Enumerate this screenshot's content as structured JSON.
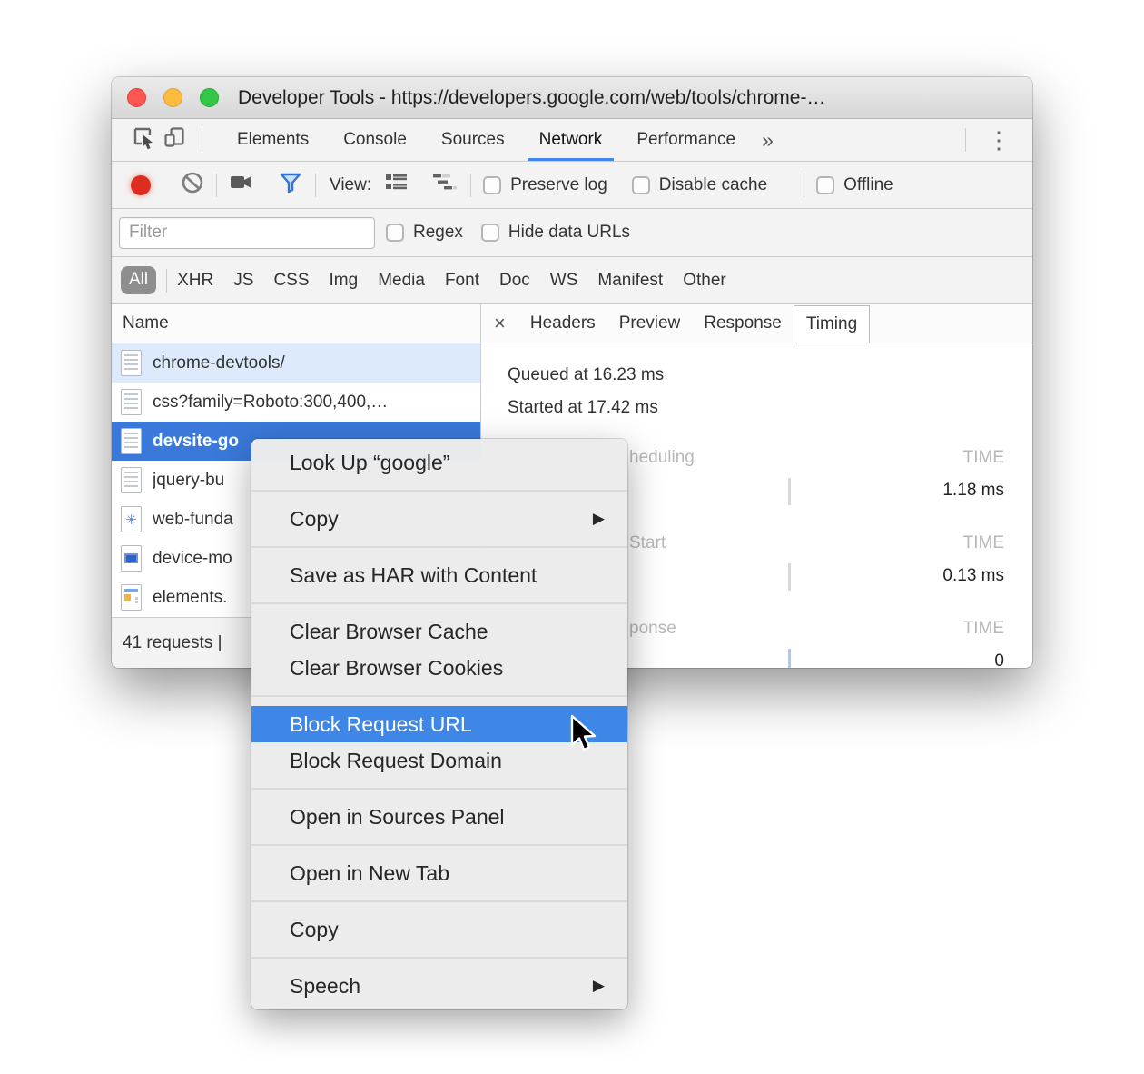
{
  "titlebar": {
    "title": "Developer Tools - https://developers.google.com/web/tools/chrome-…"
  },
  "tabbar": {
    "tabs": [
      "Elements",
      "Console",
      "Sources",
      "Network",
      "Performance"
    ],
    "active_tab": "Network",
    "overflow_chevron": "»",
    "kebab": "⋮"
  },
  "toolbar": {
    "view_label": "View:",
    "preserve_log": "Preserve log",
    "disable_cache": "Disable cache",
    "offline": "Offline"
  },
  "filter_bar": {
    "placeholder": "Filter",
    "regex": "Regex",
    "hide_data_urls": "Hide data URLs"
  },
  "type_filters": {
    "all": "All",
    "others": [
      "XHR",
      "JS",
      "CSS",
      "Img",
      "Media",
      "Font",
      "Doc",
      "WS",
      "Manifest",
      "Other"
    ]
  },
  "table": {
    "name_header": "Name",
    "rows": [
      "chrome-devtools/",
      "css?family=Roboto:300,400,…",
      "devsite-go",
      "jquery-bu",
      "web-funda",
      "device-mo",
      "elements."
    ],
    "selected_row": "devsite-go",
    "status": "41 requests |"
  },
  "panel": {
    "close": "×",
    "tabs": [
      "Headers",
      "Preview",
      "Response",
      "Timing"
    ],
    "active_tab": "Timing",
    "timing": {
      "queued": "Queued at 16.23 ms",
      "started": "Started at 17.42 ms",
      "sections": [
        {
          "label": "heduling",
          "time_header": "TIME",
          "value": "1.18 ms"
        },
        {
          "label": "Start",
          "time_header": "TIME",
          "value": "0.13 ms"
        },
        {
          "label": "ponse",
          "time_header": "TIME",
          "value": "0"
        }
      ]
    }
  },
  "context_menu": {
    "submenu_arrow": "▶",
    "items": {
      "look_up": "Look Up “google”",
      "copy": "Copy",
      "save_har": "Save as HAR with Content",
      "clear_cache": "Clear Browser Cache",
      "clear_cookies": "Clear Browser Cookies",
      "block_url": "Block Request URL",
      "block_domain": "Block Request Domain",
      "open_sources": "Open in Sources Panel",
      "open_new_tab": "Open in New Tab",
      "copy2": "Copy",
      "speech": "Speech"
    }
  },
  "colors": {
    "accent_blue": "#4285f4",
    "selection_blue": "#3a79d9",
    "menu_highlight_blue": "#3e87e6",
    "record_red": "#dd2c20"
  }
}
